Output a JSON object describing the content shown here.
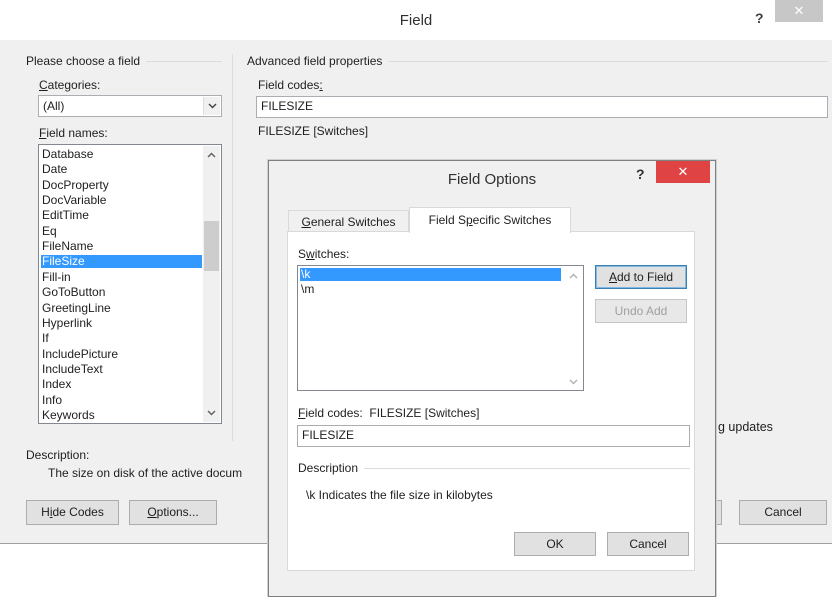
{
  "field_dialog": {
    "title": "Field",
    "help_glyph": "?",
    "close_glyph": "✕",
    "choose_group_title": "Please choose a field",
    "categories": {
      "label_u": "C",
      "label_rest": "ategories:",
      "value": "(All)"
    },
    "field_names": {
      "label_u": "F",
      "label_rest": "ield names:",
      "items": [
        "Database",
        "Date",
        "DocProperty",
        "DocVariable",
        "EditTime",
        "Eq",
        "FileName",
        "FileSize",
        "Fill-in",
        "GoToButton",
        "GreetingLine",
        "Hyperlink",
        "If",
        "IncludePicture",
        "IncludeText",
        "Index",
        "Info",
        "Keywords"
      ],
      "selected": "FileSize"
    },
    "advanced_group_title": "Advanced field properties",
    "field_codes": {
      "label_rest": "Field codes",
      "label_u": ":",
      "value": "FILESIZE",
      "syntax": "FILESIZE [Switches]"
    },
    "preserve_tail": "g updates",
    "description": {
      "label": "Description:",
      "text": "The size on disk of the active docum"
    },
    "buttons": {
      "hide_codes": {
        "pre": "H",
        "u": "i",
        "post": "de Codes"
      },
      "options": {
        "pre": "",
        "u": "O",
        "post": "ptions..."
      },
      "cancel": "Cancel"
    }
  },
  "field_options": {
    "title": "Field Options",
    "help_glyph": "?",
    "close_glyph": "✕",
    "tabs": {
      "general": {
        "pre": "",
        "u": "G",
        "post": "eneral Switches"
      },
      "specific": {
        "pre": "Field S",
        "u": "p",
        "post": "ecific Switches"
      }
    },
    "switches_label": {
      "pre": "S",
      "u": "w",
      "post": "itches:"
    },
    "switches": [
      "\\k",
      "\\m"
    ],
    "selected_switch": "\\k",
    "add_to_field": {
      "pre": "",
      "u": "A",
      "post": "dd to Field"
    },
    "undo_add": "Undo Add",
    "field_codes_label": {
      "u": "F",
      "post": "ield codes:",
      "syntax": "FILESIZE [Switches]"
    },
    "field_codes_value": "FILESIZE",
    "description_title": "Description",
    "description_text": "\\k Indicates the file size in kilobytes",
    "ok": "OK",
    "cancel": "Cancel"
  }
}
